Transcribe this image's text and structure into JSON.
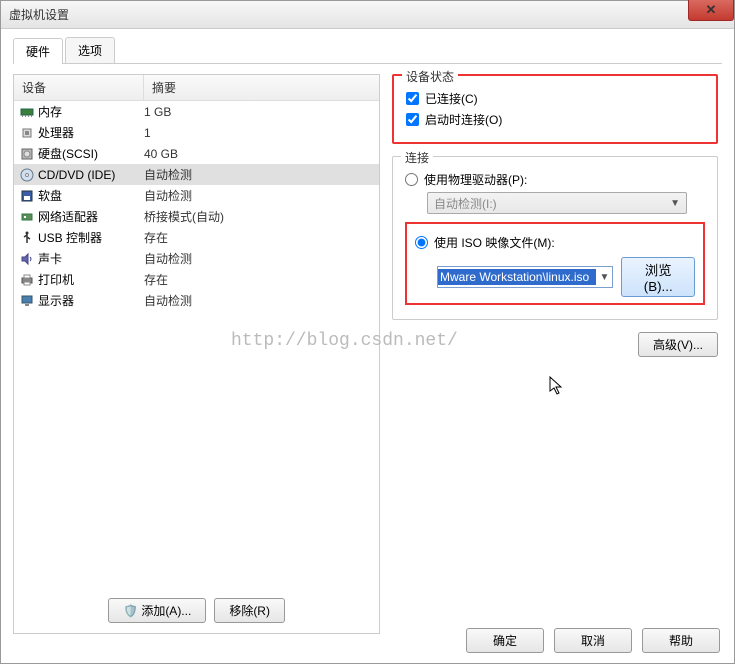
{
  "window": {
    "title": "虚拟机设置"
  },
  "tabs": {
    "hardware": "硬件",
    "options": "选项"
  },
  "hardware": {
    "header_device": "设备",
    "header_summary": "摘要",
    "items": [
      {
        "icon": "memory-icon",
        "name": "内存",
        "summary": "1 GB",
        "selected": false
      },
      {
        "icon": "cpu-icon",
        "name": "处理器",
        "summary": "1",
        "selected": false
      },
      {
        "icon": "disk-icon",
        "name": "硬盘(SCSI)",
        "summary": "40 GB",
        "selected": false
      },
      {
        "icon": "cd-icon",
        "name": "CD/DVD (IDE)",
        "summary": "自动检测",
        "selected": true
      },
      {
        "icon": "floppy-icon",
        "name": "软盘",
        "summary": "自动检测",
        "selected": false
      },
      {
        "icon": "nic-icon",
        "name": "网络适配器",
        "summary": "桥接模式(自动)",
        "selected": false
      },
      {
        "icon": "usb-icon",
        "name": "USB 控制器",
        "summary": "存在",
        "selected": false
      },
      {
        "icon": "sound-icon",
        "name": "声卡",
        "summary": "自动检测",
        "selected": false
      },
      {
        "icon": "printer-icon",
        "name": "打印机",
        "summary": "存在",
        "selected": false
      },
      {
        "icon": "display-icon",
        "name": "显示器",
        "summary": "自动检测",
        "selected": false
      }
    ],
    "add_button": "添加(A)...",
    "remove_button": "移除(R)"
  },
  "device_status": {
    "legend": "设备状态",
    "connected": {
      "label": "已连接(C)",
      "checked": true
    },
    "connect_at_power": {
      "label": "启动时连接(O)",
      "checked": true
    }
  },
  "connection": {
    "legend": "连接",
    "use_physical": {
      "label": "使用物理驱动器(P):",
      "checked": false
    },
    "physical_combo": "自动检测(I:)",
    "use_iso": {
      "label": "使用 ISO 映像文件(M):",
      "checked": true
    },
    "iso_path": "Mware Workstation\\linux.iso",
    "browse": "浏览(B)..."
  },
  "advanced_button": "高级(V)...",
  "footer": {
    "ok": "确定",
    "cancel": "取消",
    "help": "帮助"
  },
  "watermark": "http://blog.csdn.net/"
}
